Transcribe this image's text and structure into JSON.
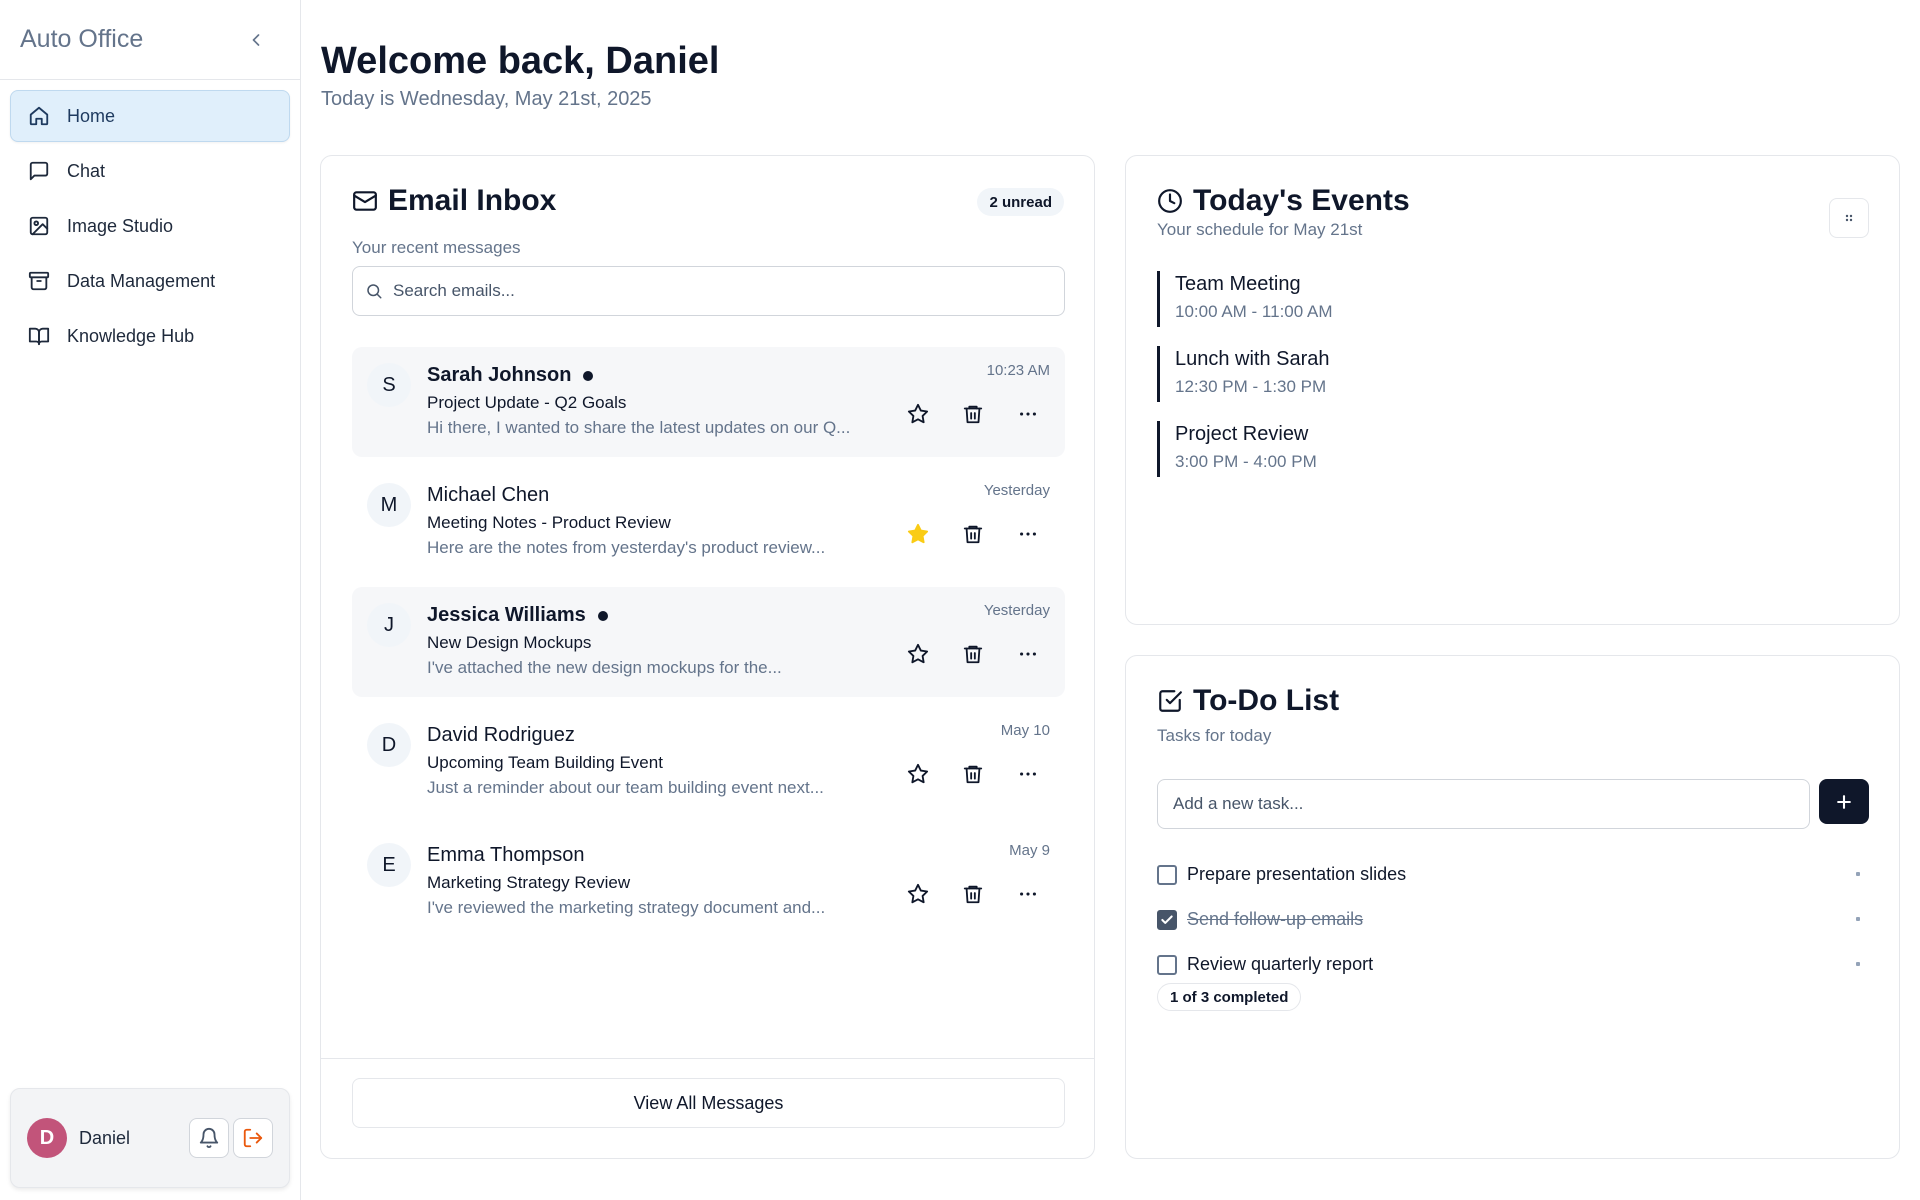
{
  "sidebar": {
    "app_title": "Auto Office",
    "items": [
      {
        "label": "Home",
        "icon": "home-icon",
        "active": true
      },
      {
        "label": "Chat",
        "icon": "chat-icon"
      },
      {
        "label": "Image Studio",
        "icon": "image-icon"
      },
      {
        "label": "Data Management",
        "icon": "archive-icon"
      },
      {
        "label": "Knowledge Hub",
        "icon": "book-icon"
      }
    ],
    "user": {
      "initial": "D",
      "name": "Daniel"
    }
  },
  "header": {
    "title": "Welcome back, Daniel",
    "subtitle": "Today is Wednesday, May 21st, 2025"
  },
  "inbox": {
    "title": "Email Inbox",
    "badge": "2 unread",
    "description": "Your recent messages",
    "search_placeholder": "Search emails...",
    "emails": [
      {
        "initial": "S",
        "sender": "Sarah Johnson",
        "subject": "Project Update - Q2 Goals",
        "preview": "Hi there, I wanted to share the latest updates on our Q...",
        "time": "10:23 AM",
        "unread": true,
        "starred": false
      },
      {
        "initial": "M",
        "sender": "Michael Chen",
        "subject": "Meeting Notes - Product Review",
        "preview": "Here are the notes from yesterday's product review...",
        "time": "Yesterday",
        "unread": false,
        "starred": true
      },
      {
        "initial": "J",
        "sender": "Jessica Williams",
        "subject": "New Design Mockups",
        "preview": "I've attached the new design mockups for the...",
        "time": "Yesterday",
        "unread": true,
        "starred": false
      },
      {
        "initial": "D",
        "sender": "David Rodriguez",
        "subject": "Upcoming Team Building Event",
        "preview": "Just a reminder about our team building event next...",
        "time": "May 10",
        "unread": false,
        "starred": false
      },
      {
        "initial": "E",
        "sender": "Emma Thompson",
        "subject": "Marketing Strategy Review",
        "preview": "I've reviewed the marketing strategy document and...",
        "time": "May 9",
        "unread": false,
        "starred": false
      }
    ],
    "view_all_label": "View All Messages"
  },
  "events": {
    "title": "Today's Events",
    "description": "Your schedule for May 21st",
    "items": [
      {
        "title": "Team Meeting",
        "time": "10:00 AM - 11:00 AM"
      },
      {
        "title": "Lunch with Sarah",
        "time": "12:30 PM - 1:30 PM"
      },
      {
        "title": "Project Review",
        "time": "3:00 PM - 4:00 PM"
      }
    ]
  },
  "todo": {
    "title": "To-Do List",
    "description": "Tasks for today",
    "input_placeholder": "Add a new task...",
    "tasks": [
      {
        "text": "Prepare presentation slides",
        "done": false
      },
      {
        "text": "Send follow-up emails",
        "done": true
      },
      {
        "text": "Review quarterly report",
        "done": false
      }
    ],
    "completed_label": "1 of 3 completed"
  },
  "colors": {
    "accent": "#0f172a",
    "active_nav_bg": "#e0effb",
    "star_filled": "#facc15",
    "avatar_bg": "#c2547a",
    "logout_icon": "#ea580c"
  }
}
